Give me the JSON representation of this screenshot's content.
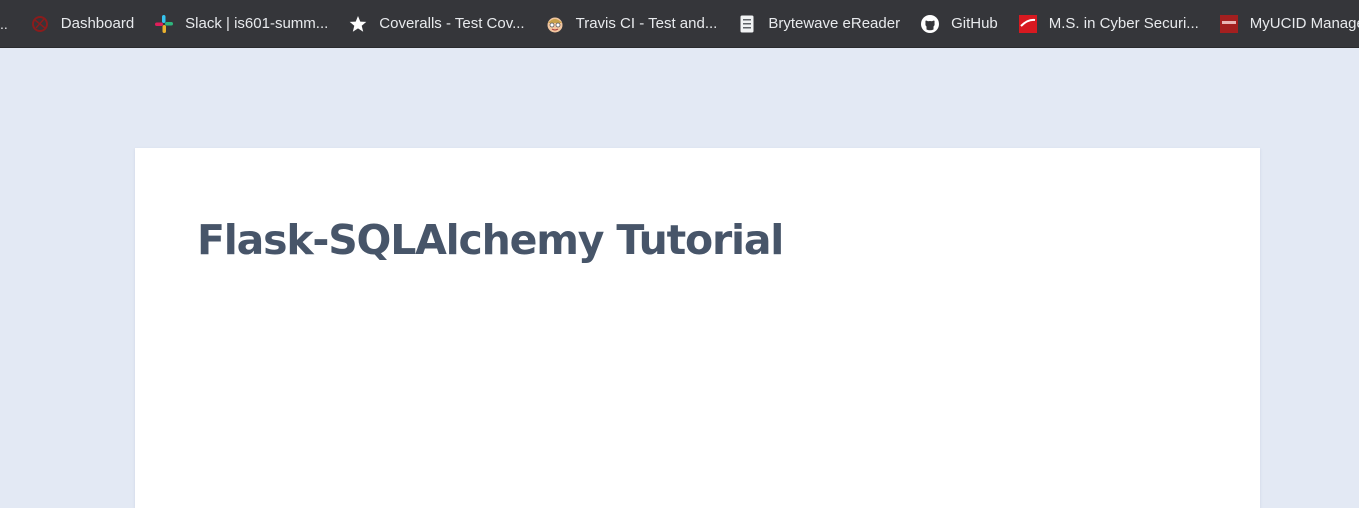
{
  "bookmarks": {
    "overflow": "..",
    "items": [
      {
        "label": "Dashboard",
        "icon": "dashboard-logo-icon"
      },
      {
        "label": "Slack | is601-summ...",
        "icon": "slack-icon"
      },
      {
        "label": "Coveralls - Test Cov...",
        "icon": "star-icon"
      },
      {
        "label": "Travis CI - Test and...",
        "icon": "travis-mascot-icon"
      },
      {
        "label": "Brytewave eReader",
        "icon": "document-icon"
      },
      {
        "label": "GitHub",
        "icon": "github-icon"
      },
      {
        "label": "M.S. in Cyber Securi...",
        "icon": "red-flag-icon"
      },
      {
        "label": "MyUCID Managem...",
        "icon": "njit-logo-icon"
      }
    ]
  },
  "main": {
    "title": "Flask-SQLAlchemy Tutorial"
  },
  "colors": {
    "bookmarks_bar": "#35363a",
    "page_background": "#e3e9f4",
    "card_background": "#ffffff",
    "title_text": "#475569"
  }
}
